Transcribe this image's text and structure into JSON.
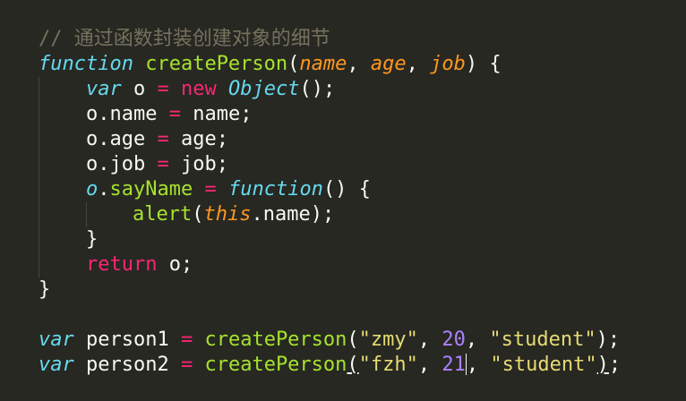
{
  "editor": {
    "theme_colors": {
      "background": "#272822",
      "comment": "#75715e",
      "keyword": "#66d9ef",
      "operator": "#f92672",
      "function_name": "#a6e22e",
      "parameter": "#fd971f",
      "string": "#e6db74",
      "number": "#ae81ff",
      "text": "#f8f8f2"
    },
    "lines": {
      "l1": {
        "comment": "// 通过函数封装创建对象的细节"
      },
      "l2": {
        "kw": "function",
        "name": "createPerson",
        "open": "(",
        "p1": "name",
        "c1": ", ",
        "p2": "age",
        "c2": ", ",
        "p3": "job",
        "close": ") {"
      },
      "l3": {
        "kw": "var",
        "var": " o ",
        "eq": "=",
        "sp": " ",
        "new": "new",
        "sp2": " ",
        "obj": "Object",
        "end": "();"
      },
      "l4": {
        "lhs": "o.name ",
        "eq": "=",
        "rhs": " name;"
      },
      "l5": {
        "lhs": "o.age ",
        "eq": "=",
        "rhs": " age;"
      },
      "l6": {
        "lhs": "o.job ",
        "eq": "=",
        "rhs": " job;"
      },
      "l7": {
        "o": "o",
        "dot": ".",
        "prop": "sayName",
        "sp": " ",
        "eq": "=",
        "sp2": " ",
        "kw": "function",
        "end": "() {"
      },
      "l8": {
        "fn": "alert",
        "open": "(",
        "this": "this",
        "rest": ".name);"
      },
      "l9": {
        "brace": "}"
      },
      "l10": {
        "ret": "return",
        "rest": " o;"
      },
      "l11": {
        "brace": "}"
      },
      "l13": {
        "kw": "var",
        "name": " person1 ",
        "eq": "=",
        "sp": " ",
        "fn": "createPerson",
        "open": "(",
        "s1": "\"zmy\"",
        "c1": ", ",
        "n1": "20",
        "c2": ", ",
        "s2": "\"student\"",
        "end": ");"
      },
      "l14": {
        "kw": "var",
        "name": " person2 ",
        "eq": "=",
        "sp": " ",
        "fn": "createPerson",
        "open": "(",
        "s1": "\"fzh\"",
        "c1": ", ",
        "n1": "21",
        "c2": ", ",
        "s2": "\"student\"",
        "close_paren": ")",
        "semi": ";"
      }
    }
  }
}
